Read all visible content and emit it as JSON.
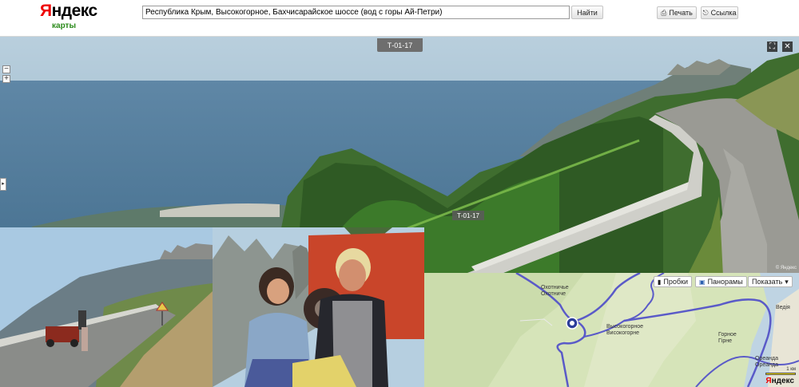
{
  "header": {
    "logo_text": "Яндекс",
    "logo_sub": "карты",
    "search_value": "Республика Крым, Высокогорное, Бахчисарайское шоссе (вод с горы Ай-Петри)",
    "find_button": "Найти",
    "print_button": "Печать",
    "link_button": "Ссылка",
    "print_icon": "printer-icon",
    "link_icon": "link-icon"
  },
  "panorama": {
    "top_label": "Т-01-17",
    "road_label": "Т-01-17",
    "zoom_in": "+",
    "zoom_out": "−",
    "expand_icon": "⛶",
    "close_icon": "✕",
    "side_arrow": "▸",
    "copyright": "© Яндекс"
  },
  "map": {
    "traffic_button": "Пробки",
    "panoramas_button": "Панорамы",
    "show_button": "Показать",
    "show_caret": "▾",
    "labels": {
      "ohotniche_top": "Охотничье",
      "ohotniche_bottom": "Охотниче",
      "vysokogornoe_top": "Высокогорное",
      "vysokogornoe_bottom": "Високогорне",
      "gornoe": "Горное",
      "gornoe2": "Гірне",
      "oreanda": "Ореанда",
      "oreanda2": "Ореанда",
      "vrezha": "Ведія"
    },
    "scale": "1 км",
    "logo": "Яндекс",
    "colors": {
      "roads": "#5a5ac8",
      "terrain": "#d6e4b9"
    }
  }
}
